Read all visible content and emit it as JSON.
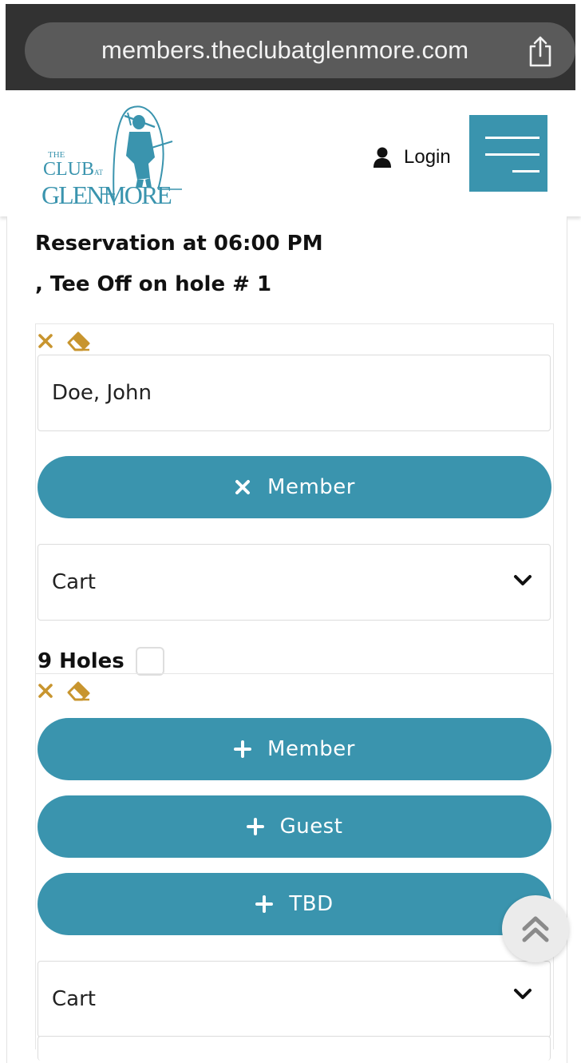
{
  "browser": {
    "url": "members.theclubatglenmore.com"
  },
  "header": {
    "logo": {
      "line1": "THE",
      "line2": "CLUB",
      "line2_small": "AT",
      "line3": "GLENMORE"
    },
    "login_label": "Login"
  },
  "reservation": {
    "title": "Reservation at 06:00 PM",
    "subtitle": ", Tee Off on hole # 1"
  },
  "slot1": {
    "player_name": "Doe, John",
    "member_button": "Member",
    "cart_value": "Cart",
    "holes_label": "9 Holes",
    "holes_checked": false
  },
  "slot2": {
    "member_button": "Member",
    "guest_button": "Guest",
    "tbd_button": "TBD",
    "cart_value": "Cart"
  },
  "colors": {
    "accent": "#3a94ae",
    "icon_gold": "#c8952e",
    "chrome_dark": "#323232"
  }
}
